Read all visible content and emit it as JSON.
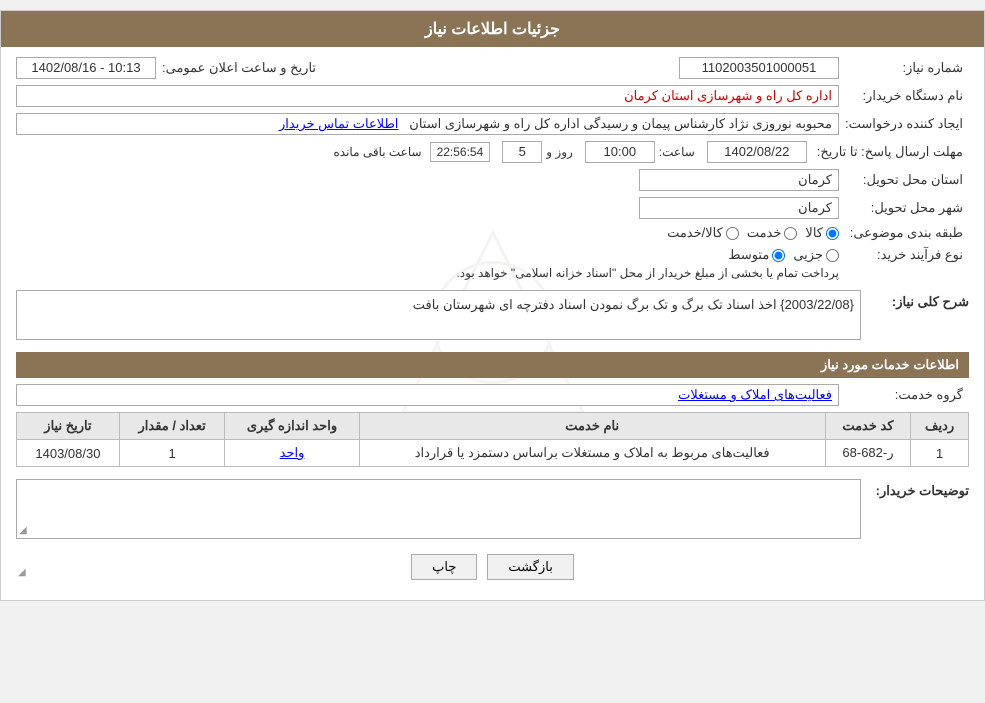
{
  "header": {
    "title": "جزئیات اطلاعات نیاز"
  },
  "fields": {
    "niaz_number_label": "شماره نیاز:",
    "niaz_number_value": "1102003501000051",
    "buyer_org_label": "نام دستگاه خریدار:",
    "buyer_org_value": "اداره کل راه و شهرسازی استان کرمان",
    "creator_label": "ایجاد کننده درخواست:",
    "creator_value": "محبوبه نوروزی نژاد کارشناس پیمان و رسیدگی اداره کل راه و شهرسازی استان",
    "creator_link": "اطلاعات تماس خریدار",
    "send_date_label": "مهلت ارسال پاسخ: تا تاریخ:",
    "send_date_value": "1402/08/22",
    "send_time_label": "ساعت:",
    "send_time_value": "10:00",
    "send_day_label": "روز و",
    "send_day_value": "5",
    "send_remaining_label": "ساعت باقی مانده",
    "send_remaining_value": "22:56:54",
    "announce_label": "تاریخ و ساعت اعلان عمومی:",
    "announce_value": "1402/08/16 - 10:13",
    "province_label": "استان محل تحویل:",
    "province_value": "کرمان",
    "city_label": "شهر محل تحویل:",
    "city_value": "کرمان",
    "category_label": "طبقه بندی موضوعی:",
    "category_options": [
      "کالا",
      "خدمت",
      "کالا/خدمت"
    ],
    "category_selected": "کالا",
    "purchase_type_label": "نوع فرآیند خرید:",
    "purchase_type_options": [
      "جزیی",
      "متوسط"
    ],
    "purchase_type_selected": "متوسط",
    "purchase_type_note": "پرداخت تمام یا بخشی از مبلغ خریدار از محل \"اسناد خزانه اسلامی\" خواهد بود."
  },
  "description_section": {
    "title": "شرح کلی نیاز:",
    "text": "{2003/22/08} اخذ اسناد تک برگ و تک برگ نمودن اسناد دفترچه ای شهرستان بافت"
  },
  "service_section": {
    "title": "اطلاعات خدمات مورد نیاز",
    "service_group_label": "گروه خدمت:",
    "service_group_value": "فعالیت‌های  املاک و مستغلات",
    "table": {
      "headers": [
        "ردیف",
        "کد خدمت",
        "نام خدمت",
        "واحد اندازه گیری",
        "تعداد / مقدار",
        "تاریخ نیاز"
      ],
      "rows": [
        {
          "row": "1",
          "code": "ر-682-68",
          "name": "فعالیت‌های مربوط به املاک و مستغلات براساس دستمزد یا قرارداد",
          "unit": "واحد",
          "quantity": "1",
          "date": "1403/08/30"
        }
      ]
    }
  },
  "buyer_comments_label": "توضیحات خریدار:",
  "buttons": {
    "print": "چاپ",
    "back": "بازگشت"
  }
}
